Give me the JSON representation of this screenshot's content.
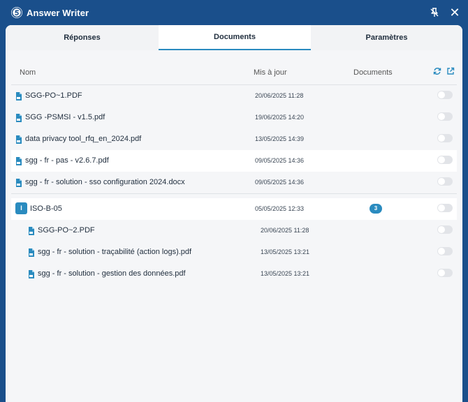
{
  "window": {
    "title": "Answer Writer",
    "close_label": "✕"
  },
  "tabs": [
    {
      "label": "Réponses",
      "active": false
    },
    {
      "label": "Documents",
      "active": true
    },
    {
      "label": "Paramètres",
      "active": false
    }
  ],
  "table": {
    "headers": {
      "name": "Nom",
      "updated": "Mis à jour",
      "documents": "Documents"
    },
    "rows": [
      {
        "name": "SGG-PO~1.PDF",
        "date": "20/06/2025 11:28",
        "enabled": false
      },
      {
        "name": "SGG -PSMSI - v1.5.pdf",
        "date": "19/06/2025 14:20",
        "enabled": false
      },
      {
        "name": "data privacy tool_rfq_en_2024.pdf",
        "date": "13/05/2025 14:39",
        "enabled": false
      },
      {
        "name": "sgg - fr - pas - v2.6.7.pdf",
        "date": "09/05/2025 14:36",
        "enabled": false
      },
      {
        "name": "sgg - fr - solution - sso configuration 2024.docx",
        "date": "09/05/2025 14:36",
        "enabled": false
      }
    ],
    "folder": {
      "badge": "I",
      "name": "ISO-B-05",
      "date": "05/05/2025 12:33",
      "count": "3",
      "enabled": false,
      "children": [
        {
          "name": "SGG-PO~2.PDF",
          "date": "20/06/2025 11:28",
          "enabled": false
        },
        {
          "name": "sgg - fr - solution - traçabilité (action logs).pdf",
          "date": "13/05/2025 13:21",
          "enabled": false
        },
        {
          "name": "sgg - fr - solution - gestion des données.pdf",
          "date": "13/05/2025 13:21",
          "enabled": false
        }
      ]
    }
  },
  "colors": {
    "brand": "#1a4f8b",
    "accent": "#2a8bbf"
  },
  "icons": [
    "app-logo-icon",
    "unpin-icon",
    "close-icon",
    "refresh-icon",
    "open-external-icon",
    "file-icon"
  ]
}
